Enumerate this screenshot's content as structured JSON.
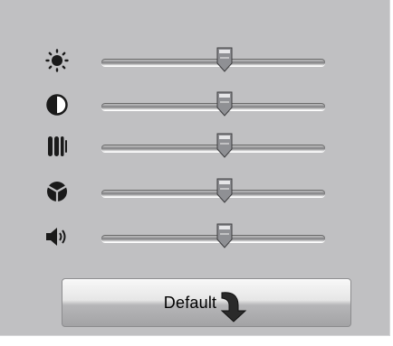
{
  "sliders": [
    {
      "id": "brightness",
      "icon": "brightness-icon",
      "value": 0.55
    },
    {
      "id": "contrast",
      "icon": "contrast-icon",
      "value": 0.55
    },
    {
      "id": "saturation",
      "icon": "saturation-icon",
      "value": 0.55
    },
    {
      "id": "hue",
      "icon": "hue-icon",
      "value": 0.55
    },
    {
      "id": "volume",
      "icon": "volume-icon",
      "value": 0.55
    }
  ],
  "default_button": {
    "label": "Default",
    "icon": "curved-arrow-down-icon"
  },
  "colors": {
    "panel": "#c0c0c2",
    "icon": "#1a1a1a",
    "thumb": "#8f9094"
  }
}
